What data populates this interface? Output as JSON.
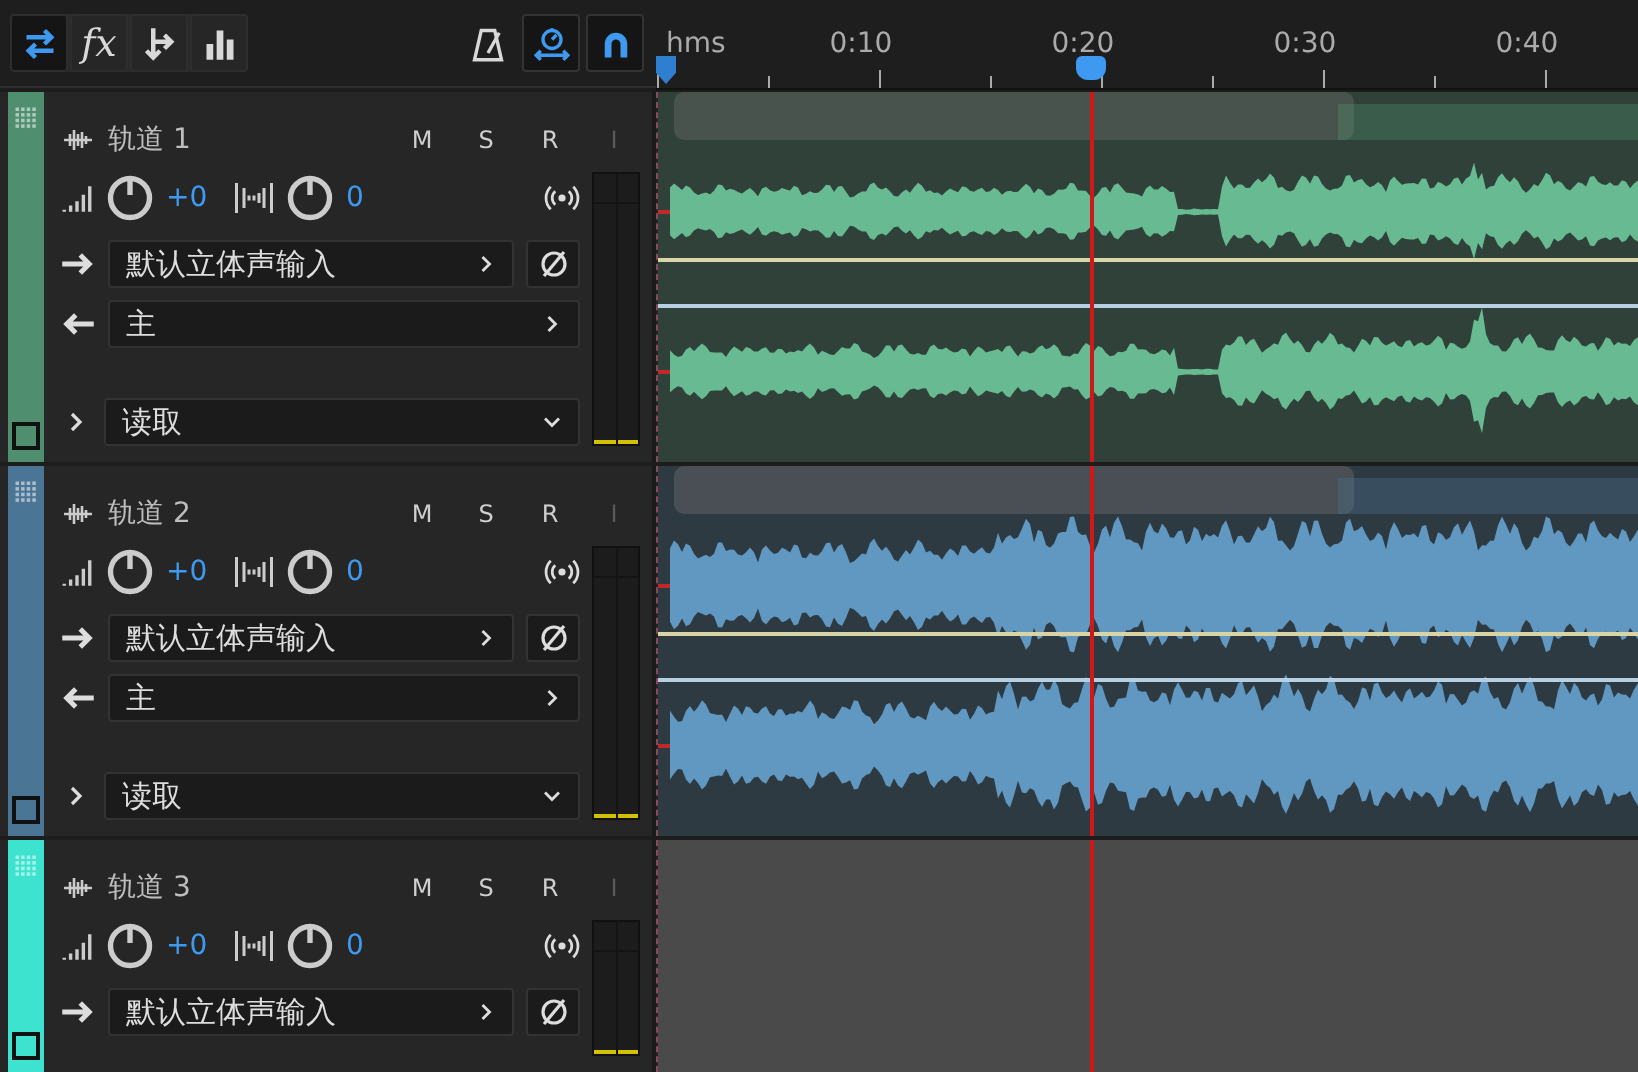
{
  "toolbar": {
    "view_buttons": [
      {
        "kind": "swap",
        "selected": true
      },
      {
        "kind": "fx",
        "label": "fx",
        "selected": false
      },
      {
        "kind": "sends",
        "selected": false
      },
      {
        "kind": "eq",
        "selected": false
      }
    ],
    "tools": [
      {
        "kind": "metronome",
        "selected": false
      },
      {
        "kind": "stretch",
        "selected": true
      },
      {
        "kind": "snap",
        "selected": true
      }
    ]
  },
  "ruler": {
    "unit": "hms",
    "labels": [
      "0:10",
      "0:20",
      "0:30",
      "0:40"
    ]
  },
  "tracks": [
    {
      "name": "轨道 1",
      "color": "#4f8f70",
      "buttons": [
        {
          "label": "M",
          "disabled": false
        },
        {
          "label": "S",
          "disabled": false
        },
        {
          "label": "R",
          "disabled": false
        },
        {
          "label": "I",
          "disabled": true
        }
      ],
      "volume": "+0",
      "pan": "0",
      "input": "默认立体声输入",
      "output": "主",
      "automation": "读取",
      "clip": true
    },
    {
      "name": "轨道 2",
      "color": "#4a7595",
      "buttons": [
        {
          "label": "M",
          "disabled": false
        },
        {
          "label": "S",
          "disabled": false
        },
        {
          "label": "R",
          "disabled": false
        },
        {
          "label": "I",
          "disabled": true
        }
      ],
      "volume": "+0",
      "pan": "0",
      "input": "默认立体声输入",
      "output": "主",
      "automation": "读取",
      "clip": true
    },
    {
      "name": "轨道 3",
      "color": "#3ee3cf",
      "buttons": [
        {
          "label": "M",
          "disabled": false
        },
        {
          "label": "S",
          "disabled": false
        },
        {
          "label": "R",
          "disabled": false
        },
        {
          "label": "I",
          "disabled": true
        }
      ],
      "volume": "+0",
      "pan": "0",
      "input": "默认立体声输入",
      "clip": false
    }
  ]
}
